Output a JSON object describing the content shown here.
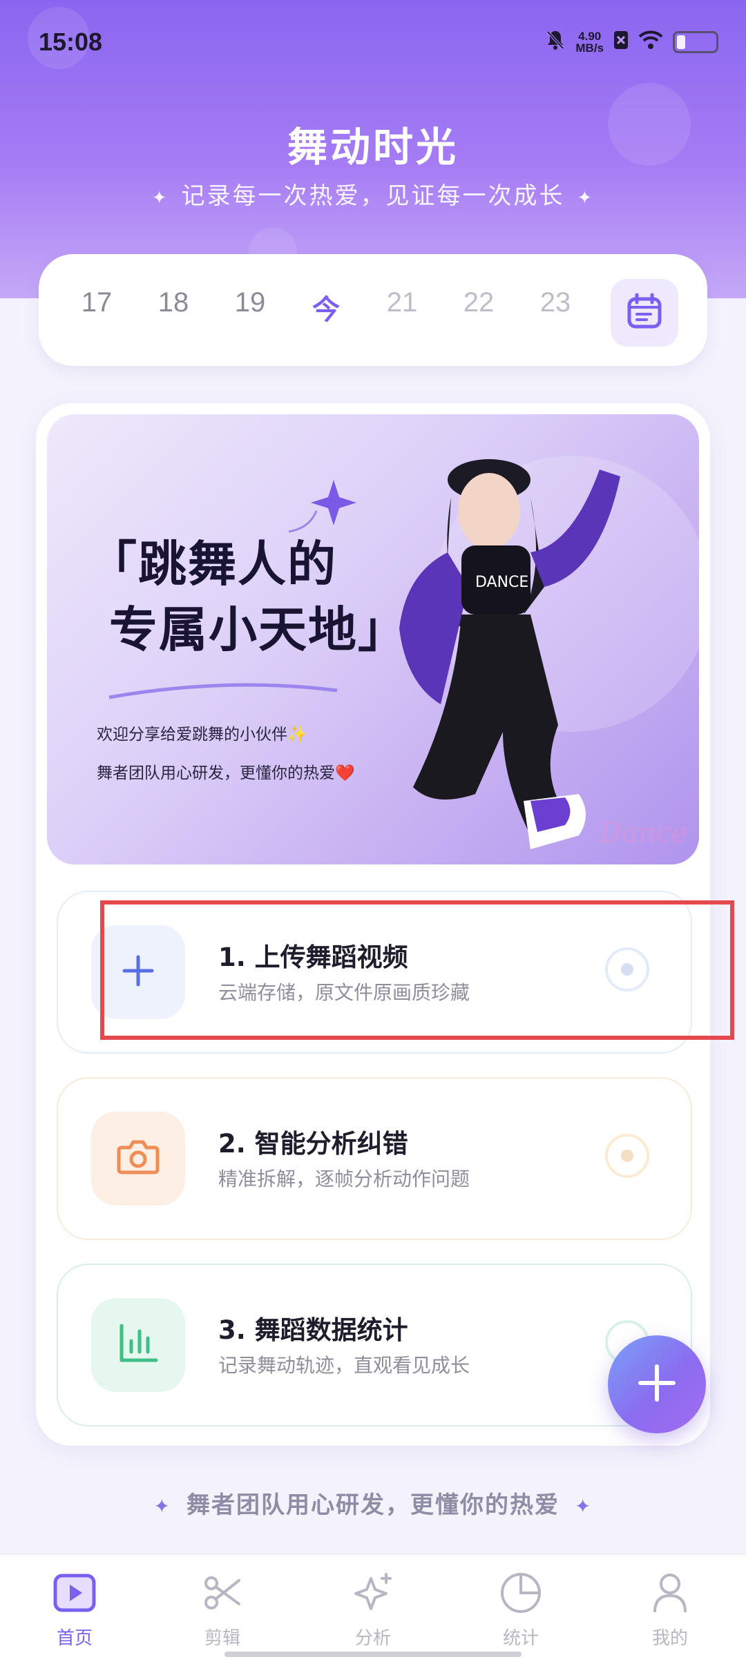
{
  "status_bar": {
    "time": "15:08",
    "net_speed_value": "4.90",
    "net_speed_unit": "MB/s"
  },
  "header": {
    "title": "舞动时光",
    "subtitle": "记录每一次热爱，见证每一次成长",
    "sparkle": "✦"
  },
  "date_strip": {
    "dates": [
      "17",
      "18",
      "19",
      "今",
      "21",
      "22",
      "23"
    ],
    "selected": "今",
    "calendar_icon": "calendar-icon"
  },
  "banner": {
    "title_line1": "「跳舞人的",
    "title_line2": "专属小天地」",
    "line1": "欢迎分享给爱跳舞的小伙伴✨",
    "line2": "舞者团队用心研发，更懂你的热爱❤️"
  },
  "steps": [
    {
      "title": "1. 上传舞蹈视频",
      "desc": "云端存储，原文件原画质珍藏",
      "icon": "plus-icon",
      "color": "#5a6ee6"
    },
    {
      "title": "2. 智能分析纠错",
      "desc": "精准拆解，逐帧分析动作问题",
      "icon": "camera-icon",
      "color": "#ee8d55"
    },
    {
      "title": "3. 舞蹈数据统计",
      "desc": "记录舞动轨迹，直观看见成长",
      "icon": "bar-chart-icon",
      "color": "#3fbf86"
    }
  ],
  "footer": {
    "slogan": "舞者团队用心研发，更懂你的热爱"
  },
  "bottom_nav": [
    {
      "label": "首页",
      "icon": "play-icon",
      "active": true
    },
    {
      "label": "剪辑",
      "icon": "scissors-icon",
      "active": false
    },
    {
      "label": "分析",
      "icon": "sparkle-icon",
      "active": false
    },
    {
      "label": "统计",
      "icon": "pie-chart-icon",
      "active": false
    },
    {
      "label": "我的",
      "icon": "user-icon",
      "active": false
    }
  ],
  "colors": {
    "accent": "#7b5ff1",
    "highlight": "#e5484d",
    "header_gradient_top": "#8a66f0"
  }
}
